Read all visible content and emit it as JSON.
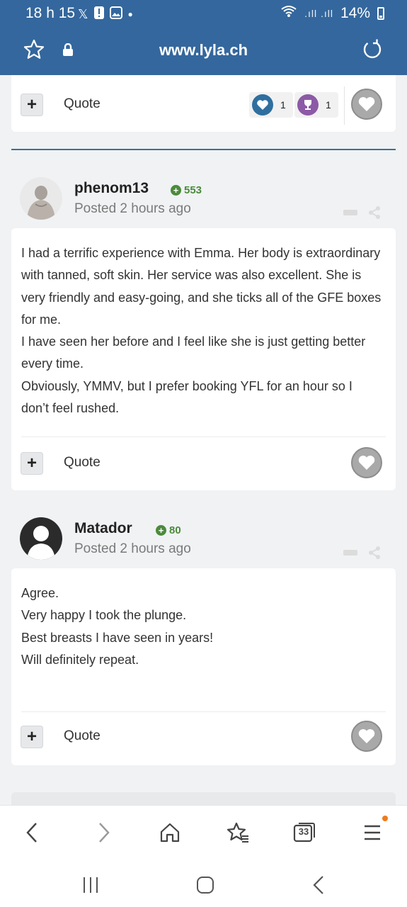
{
  "status_bar": {
    "time": "18 h 15",
    "battery": "14%"
  },
  "url_bar": {
    "url": "www.lyla.ch"
  },
  "first_card": {
    "quote_label": "Quote",
    "reactions": [
      {
        "icon": "heart-reaction-icon",
        "count": "1"
      },
      {
        "icon": "trophy-reaction-icon",
        "count": "1"
      }
    ]
  },
  "posts": [
    {
      "username": "phenom13",
      "points": "553",
      "posted": "Posted 2 hours ago",
      "paragraphs": [
        "I had a terrific experience with Emma. Her body is extraordinary with tanned, soft skin. Her service was also excellent. She is very friendly and easy-going, and she ticks all of the GFE boxes for me.",
        "I have seen her before and I feel like she is just getting better every time.",
        "Obviously, YMMV, but I prefer booking YFL for an hour so I don’t feel rushed."
      ],
      "quote_label": "Quote"
    },
    {
      "username": "Matador",
      "points": "80",
      "posted": "Posted 2 hours ago",
      "paragraphs": [
        "Agree.",
        "Very happy I took the plunge.",
        "Best breasts I have seen in years!",
        "Will definitely repeat."
      ],
      "quote_label": "Quote"
    }
  ],
  "toolbar": {
    "tab_count": "33"
  },
  "colors": {
    "header": "#34679d",
    "points": "#4b8a3b",
    "divider": "#3f6f8f",
    "notification_dot": "#f07a1a"
  }
}
